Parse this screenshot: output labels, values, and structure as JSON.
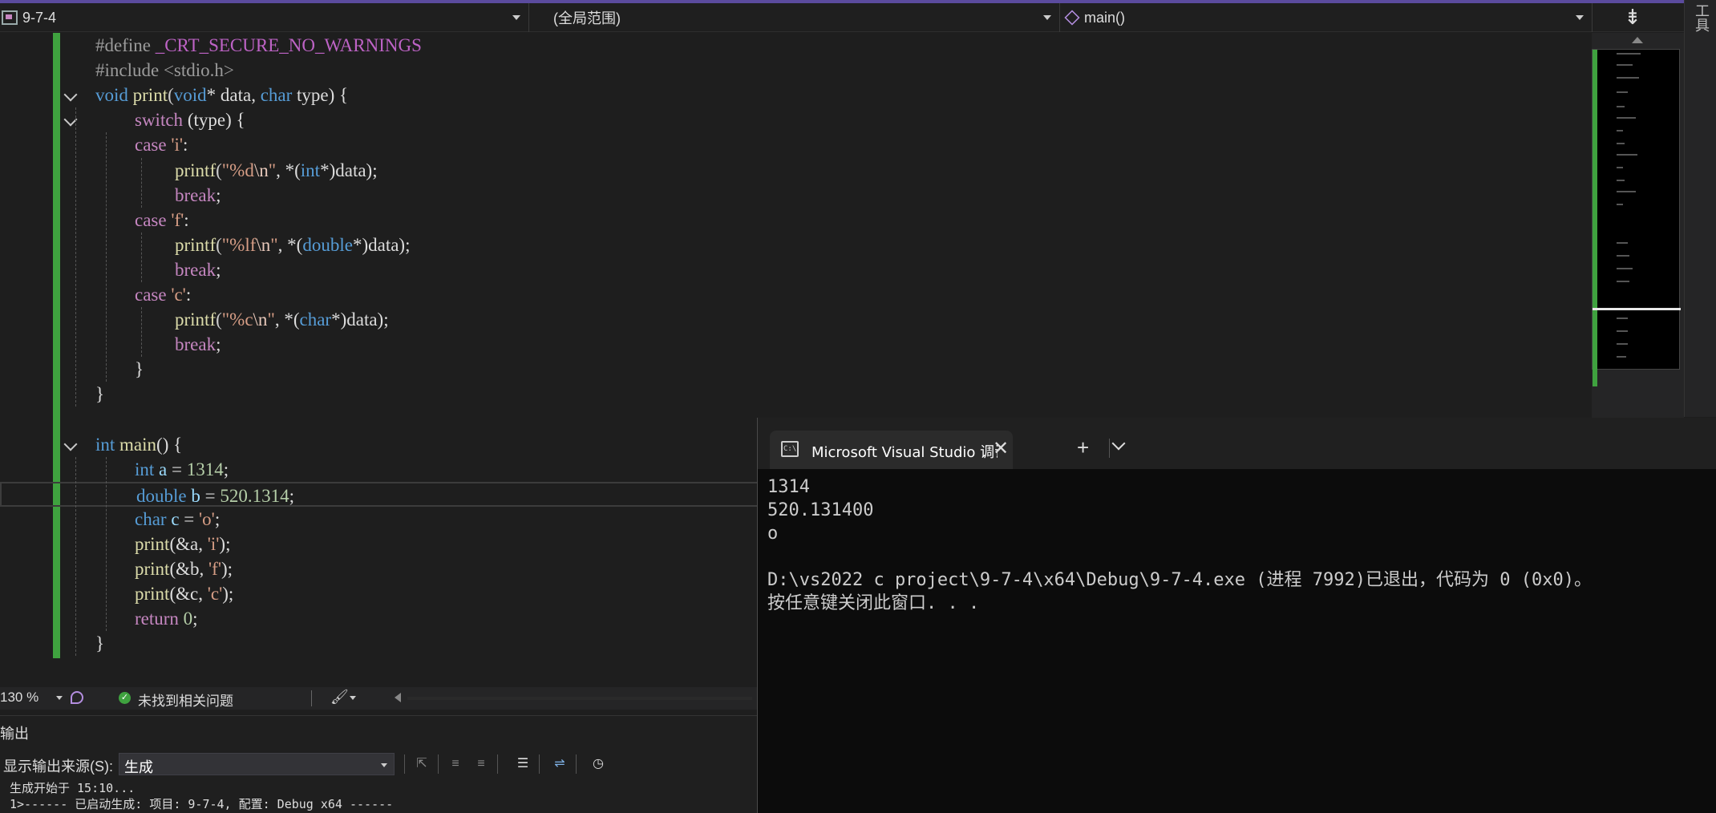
{
  "navbar": {
    "project": "9-7-4",
    "scope": "(全局范围)",
    "function": "main()",
    "split_icon": "split-view-icon"
  },
  "side_tab": {
    "label": "工具"
  },
  "editor": {
    "lines": [
      [
        "#define",
        " _CRT_SECURE_NO_WARNINGS"
      ],
      [
        "#include",
        " <stdio.h>"
      ],
      [
        "void",
        " print",
        "(",
        "void",
        "* data, ",
        "char",
        " type) {"
      ],
      [
        "switch",
        " (type) {"
      ],
      [
        "case",
        " 'i'",
        ":"
      ],
      [
        "printf",
        "(",
        "\"%d",
        "\\n",
        "\"",
        ", *(",
        "int",
        "*)data);"
      ],
      [
        "break",
        ";"
      ],
      [
        "case",
        " 'f'",
        ":"
      ],
      [
        "printf",
        "(",
        "\"%lf",
        "\\n",
        "\"",
        ", *(",
        "double",
        "*)data);"
      ],
      [
        "break",
        ";"
      ],
      [
        "case",
        " 'c'",
        ":"
      ],
      [
        "printf",
        "(",
        "\"%c",
        "\\n",
        "\"",
        ", *(",
        "char",
        "*)data);"
      ],
      [
        "break",
        ";"
      ],
      [
        "}"
      ],
      [
        "}"
      ],
      [
        ""
      ],
      [
        "int",
        " main",
        "() {"
      ],
      [
        "int",
        " a",
        " = ",
        "1314",
        ";"
      ],
      [
        "double",
        " b",
        " = ",
        "520.1314",
        ";"
      ],
      [
        "char",
        " c",
        " = ",
        "'o'",
        ";"
      ],
      [
        "print",
        "(&a, ",
        "'i'",
        ");"
      ],
      [
        "print",
        "(&b, ",
        "'f'",
        ");"
      ],
      [
        "print",
        "(&c, ",
        "'c'",
        ");"
      ],
      [
        "return",
        " ",
        "0",
        ";"
      ],
      [
        "}"
      ]
    ]
  },
  "console": {
    "tab_title": "Microsoft Visual Studio 调试控制台",
    "new_tab": "+",
    "output_lines": [
      "1314",
      "520.131400",
      "o",
      "",
      "D:\\vs2022 c project\\9-7-4\\x64\\Debug\\9-7-4.exe (进程 7992)已退出，代码为 0 (0x0)。",
      "按任意键关闭此窗口. . ."
    ]
  },
  "statusbar": {
    "zoom": "130 %",
    "issues": "未找到相关问题"
  },
  "output_panel": {
    "title": "输出",
    "source_label": "显示输出来源(S):",
    "source_value": "生成",
    "lines": [
      "生成开始于 15:10...",
      "1>------ 已启动生成: 项目: 9-7-4, 配置: Debug x64 ------"
    ]
  },
  "colors": {
    "accent": "#5b4b9e",
    "change_bar": "#3fa23f",
    "keyword": "#c586c0",
    "type": "#569cd6",
    "function": "#dcdcaa",
    "string": "#d69d85",
    "number": "#b5cea8"
  }
}
